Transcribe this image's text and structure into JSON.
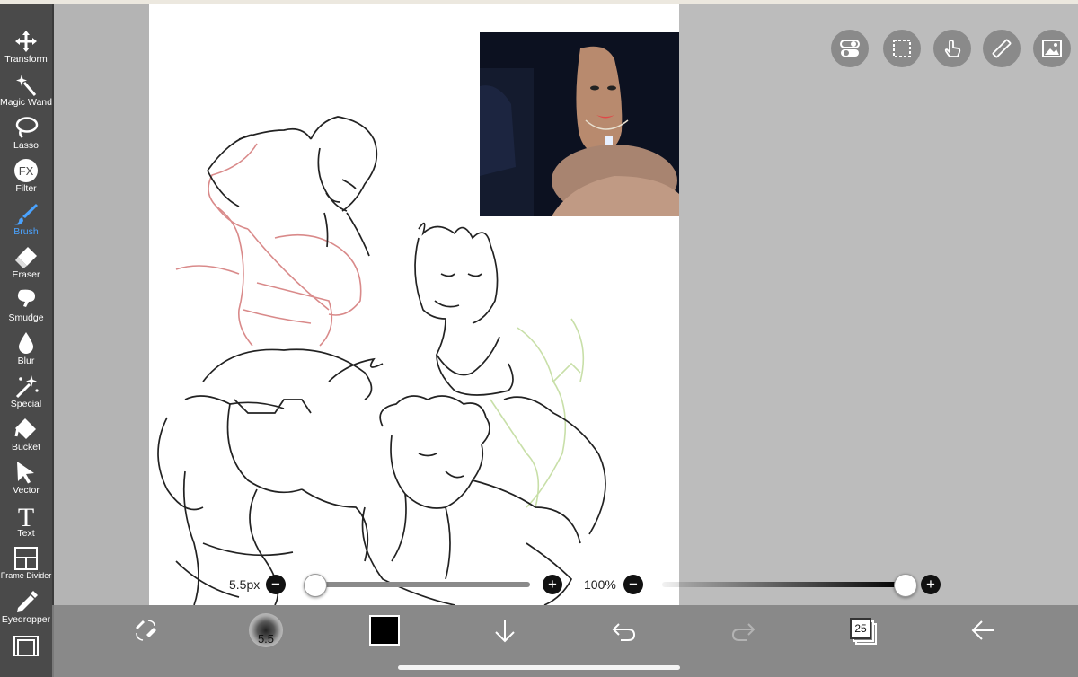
{
  "tools": [
    {
      "label": "Transform",
      "icon": "move-arrows-icon"
    },
    {
      "label": "Magic Wand",
      "icon": "magic-wand-icon"
    },
    {
      "label": "Lasso",
      "icon": "lasso-icon"
    },
    {
      "label": "Filter",
      "icon": "fx-icon",
      "glyph": "FX"
    },
    {
      "label": "Brush",
      "icon": "brush-icon",
      "active": true
    },
    {
      "label": "Eraser",
      "icon": "eraser-icon"
    },
    {
      "label": "Smudge",
      "icon": "smudge-icon"
    },
    {
      "label": "Blur",
      "icon": "drop-icon"
    },
    {
      "label": "Special",
      "icon": "sparkle-wand-icon"
    },
    {
      "label": "Bucket",
      "icon": "bucket-icon"
    },
    {
      "label": "Vector",
      "icon": "cursor-arrow-icon"
    },
    {
      "label": "Text",
      "icon": "text-icon",
      "glyph": "T"
    },
    {
      "label": "Frame Divider",
      "icon": "frame-divider-icon"
    },
    {
      "label": "Eyedropper",
      "icon": "eyedropper-icon"
    }
  ],
  "brush": {
    "size_label": "5.5px",
    "size_fraction": 0.04,
    "opacity_label": "100%",
    "opacity_fraction": 1.0
  },
  "bottom": {
    "brush_preview_label": "5.5",
    "layer_count": "25",
    "color": "#000000"
  },
  "accent": "#4aa3ff"
}
